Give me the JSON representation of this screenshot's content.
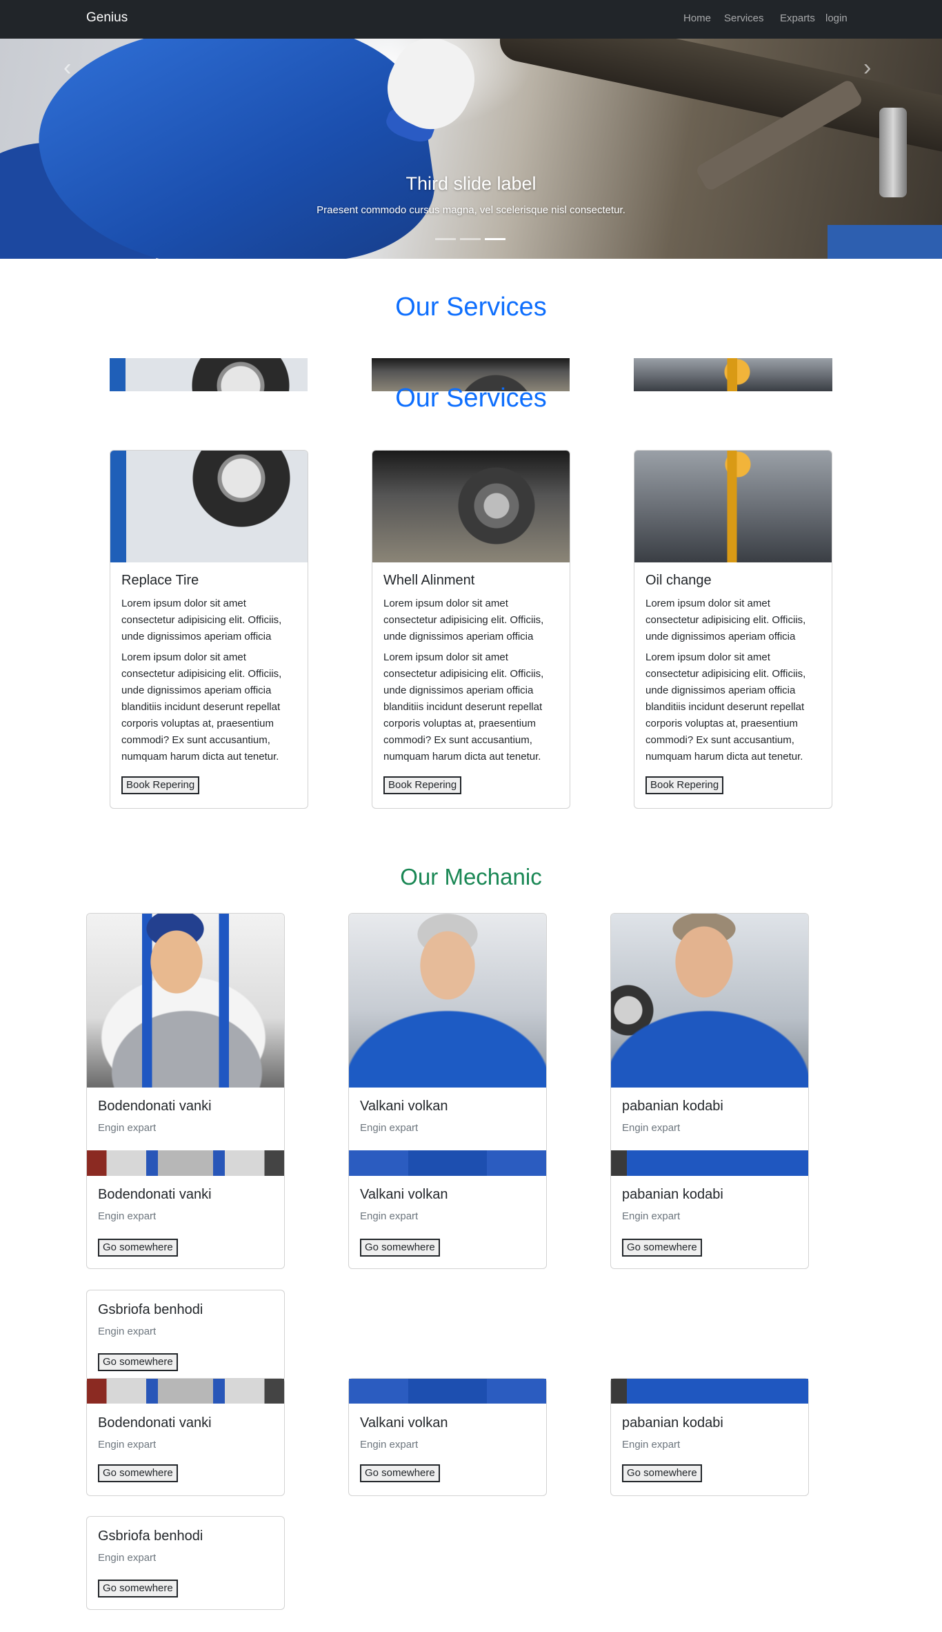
{
  "navbar": {
    "brand": "Genius",
    "links": [
      "Home",
      "Services",
      "Exparts",
      "login"
    ]
  },
  "carousel": {
    "title": "Third slide label",
    "text": "Praesent commodo cursus magna, vel scelerisque nisl consectetur.",
    "prev_icon": "chevron-left-icon",
    "next_icon": "chevron-right-icon",
    "slide_count": 3,
    "active_slide": 3
  },
  "services": {
    "title": "Our Services",
    "cards": [
      {
        "title": "Replace Tire",
        "text1": [
          "Lorem ipsum dolor sit amet",
          "consectetur adipisicing elit. Officiis,",
          "unde dignissimos aperiam officia"
        ],
        "text2": [
          "Lorem ipsum dolor sit amet",
          "consectetur adipisicing elit. Officiis,",
          "unde dignissimos aperiam officia",
          "blanditiis incidunt deserunt repellat",
          "corporis voluptas at, praesentium",
          "commodi? Ex sunt accusantium,",
          "numquam harum dicta aut tenetur."
        ],
        "button": "Book Repering"
      },
      {
        "title": "Whell Alinment",
        "text1": [
          "Lorem ipsum dolor sit amet",
          "consectetur adipisicing elit. Officiis,",
          "unde dignissimos aperiam officia"
        ],
        "text2": [
          "Lorem ipsum dolor sit amet",
          "consectetur adipisicing elit. Officiis,",
          "unde dignissimos aperiam officia",
          "blanditiis incidunt deserunt repellat",
          "corporis voluptas at, praesentium",
          "commodi? Ex sunt accusantium,",
          "numquam harum dicta aut tenetur."
        ],
        "button": "Book Repering"
      },
      {
        "title": "Oil change",
        "text1": [
          "Lorem ipsum dolor sit amet",
          "consectetur adipisicing elit. Officiis,",
          "unde dignissimos aperiam officia"
        ],
        "text2": [
          "Lorem ipsum dolor sit amet",
          "consectetur adipisicing elit. Officiis,",
          "unde dignissimos aperiam officia",
          "blanditiis incidunt deserunt repellat",
          "corporis voluptas at, praesentium",
          "commodi? Ex sunt accusantium,",
          "numquam harum dicta aut tenetur."
        ],
        "button": "Book Repering"
      }
    ]
  },
  "mechanics": {
    "title": "Our Mechanic",
    "role": "Engin expart",
    "button": "Go somewhere",
    "names": [
      "Bodendonati vanki",
      "Valkani volkan",
      "pabanian kodabi",
      "Gsbriofa benhodi"
    ]
  },
  "colors": {
    "primary": "#0d6efd",
    "success": "#198754",
    "navbar": "#212529"
  }
}
